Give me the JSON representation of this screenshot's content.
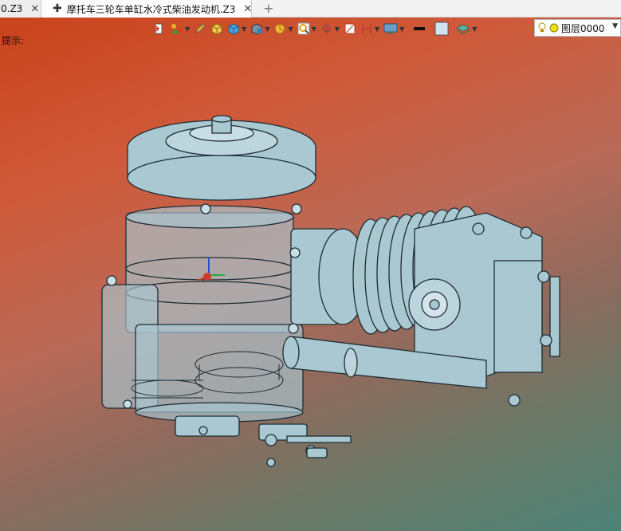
{
  "tabs": [
    {
      "label": "0.Z3",
      "active": false
    },
    {
      "label": "摩托车三轮车单缸水冷式柴油发动机.Z3",
      "active": true
    }
  ],
  "tab_close_glyph": "✕",
  "tab_modified_glyph": "✚",
  "new_tab_glyph": "+",
  "hint_text": "提示:",
  "toolbar": {
    "icons": [
      "view-transform-icon",
      "point-snap-icon",
      "pencil-icon",
      "box-shade-icon",
      "solid-cube-icon",
      "render-mode-icon",
      "pie-display-icon",
      "zoom-icon",
      "pick-filter-icon",
      "section-icon",
      "dimension-icon",
      "display-settings-icon",
      "line-color-icon",
      "face-color-icon",
      "layer-stack-icon"
    ],
    "line_color": "#111111",
    "face_color": "#cfe6f2"
  },
  "layer": {
    "label": "图层0000",
    "lightbulb": "lightbulb-icon",
    "status_color": "#e9e21d"
  },
  "colors": {
    "model": "#a9c8d2",
    "model_edge": "#1e2c33",
    "bg_top": "#c9431b",
    "bg_bottom": "#4c8377"
  }
}
